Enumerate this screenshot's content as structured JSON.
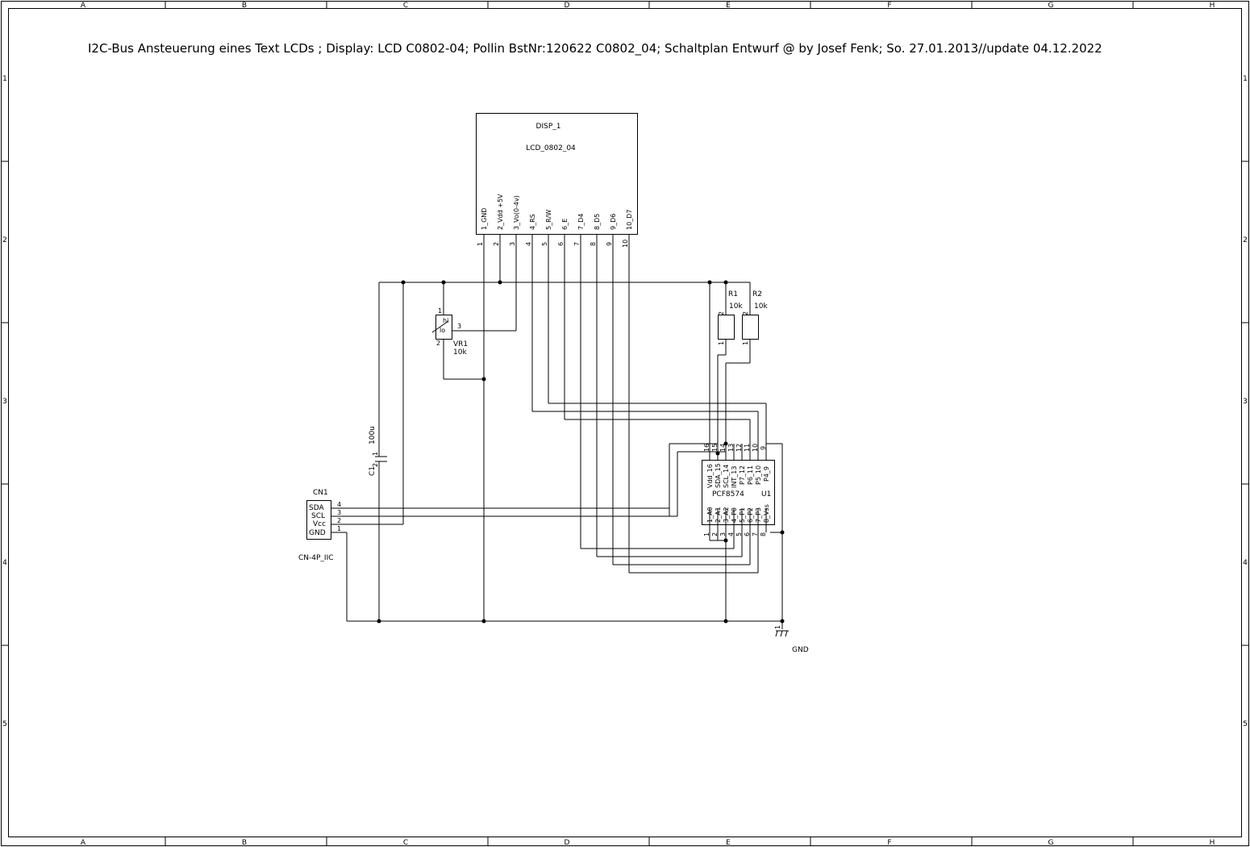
{
  "title": "I2C-Bus Ansteuerung eines Text LCDs ; Display: LCD C0802-04; Pollin BstNr:120622 C0802_04; Schaltplan Entwurf @ by Josef Fenk; So. 27.01.2013//update 04.12.2022",
  "frame": {
    "columns": [
      "A",
      "B",
      "C",
      "D",
      "E",
      "F",
      "G",
      "H"
    ],
    "rows": [
      "1",
      "2",
      "3",
      "4",
      "5"
    ]
  },
  "display": {
    "ref": "DISP_1",
    "value": "LCD_0802_04",
    "pins": [
      {
        "num": "1",
        "name": "1_GND"
      },
      {
        "num": "2",
        "name": "2_Vdd +5V"
      },
      {
        "num": "3",
        "name": "3_Vo(0-4v)"
      },
      {
        "num": "4",
        "name": "4_RS"
      },
      {
        "num": "5",
        "name": "5_R/W"
      },
      {
        "num": "6",
        "name": "6_E"
      },
      {
        "num": "7",
        "name": "7_D4"
      },
      {
        "num": "8",
        "name": "8_D5"
      },
      {
        "num": "9",
        "name": "9_D6"
      },
      {
        "num": "10",
        "name": "10_D7"
      }
    ]
  },
  "vr1": {
    "ref": "VR1",
    "value": "10k",
    "pin1": "1",
    "pin2": "2",
    "pin3": "3",
    "lo": "lo",
    "hi": "hi"
  },
  "r1": {
    "ref": "R1",
    "value": "10k",
    "pin_top": "2",
    "pin_bottom": "1"
  },
  "r2": {
    "ref": "R2",
    "value": "10k",
    "pin_top": "2",
    "pin_bottom": "1"
  },
  "c1": {
    "ref": "C1",
    "value": "100u",
    "pin1": "1",
    "pin2": "2"
  },
  "cn1": {
    "ref": "CN1",
    "value": "CN-4P_IIC",
    "pins": [
      {
        "num": "4",
        "name": "SDA"
      },
      {
        "num": "3",
        "name": "SCL"
      },
      {
        "num": "2",
        "name": "Vcc"
      },
      {
        "num": "1",
        "name": "GND"
      }
    ]
  },
  "u1": {
    "ref": "U1",
    "value": "PCF8574",
    "top_pins": [
      {
        "num": "16",
        "name": "Vdd_16"
      },
      {
        "num": "15",
        "name": "SDA_15"
      },
      {
        "num": "14",
        "name": "SCL_14"
      },
      {
        "num": "13",
        "name": "INT_13"
      },
      {
        "num": "12",
        "name": "P7_12"
      },
      {
        "num": "11",
        "name": "P6_11"
      },
      {
        "num": "10",
        "name": "P5_10"
      },
      {
        "num": "9",
        "name": "P4_9"
      }
    ],
    "bottom_pins": [
      {
        "num": "1",
        "name": "1_A0"
      },
      {
        "num": "2",
        "name": "2_A1"
      },
      {
        "num": "3",
        "name": "3_A2"
      },
      {
        "num": "4",
        "name": "4_P0"
      },
      {
        "num": "5",
        "name": "5_P1"
      },
      {
        "num": "6",
        "name": "6_P2"
      },
      {
        "num": "7",
        "name": "7_P3"
      },
      {
        "num": "8",
        "name": "8_Vss"
      }
    ]
  },
  "gnd": {
    "label": "GND",
    "pin": "1"
  }
}
